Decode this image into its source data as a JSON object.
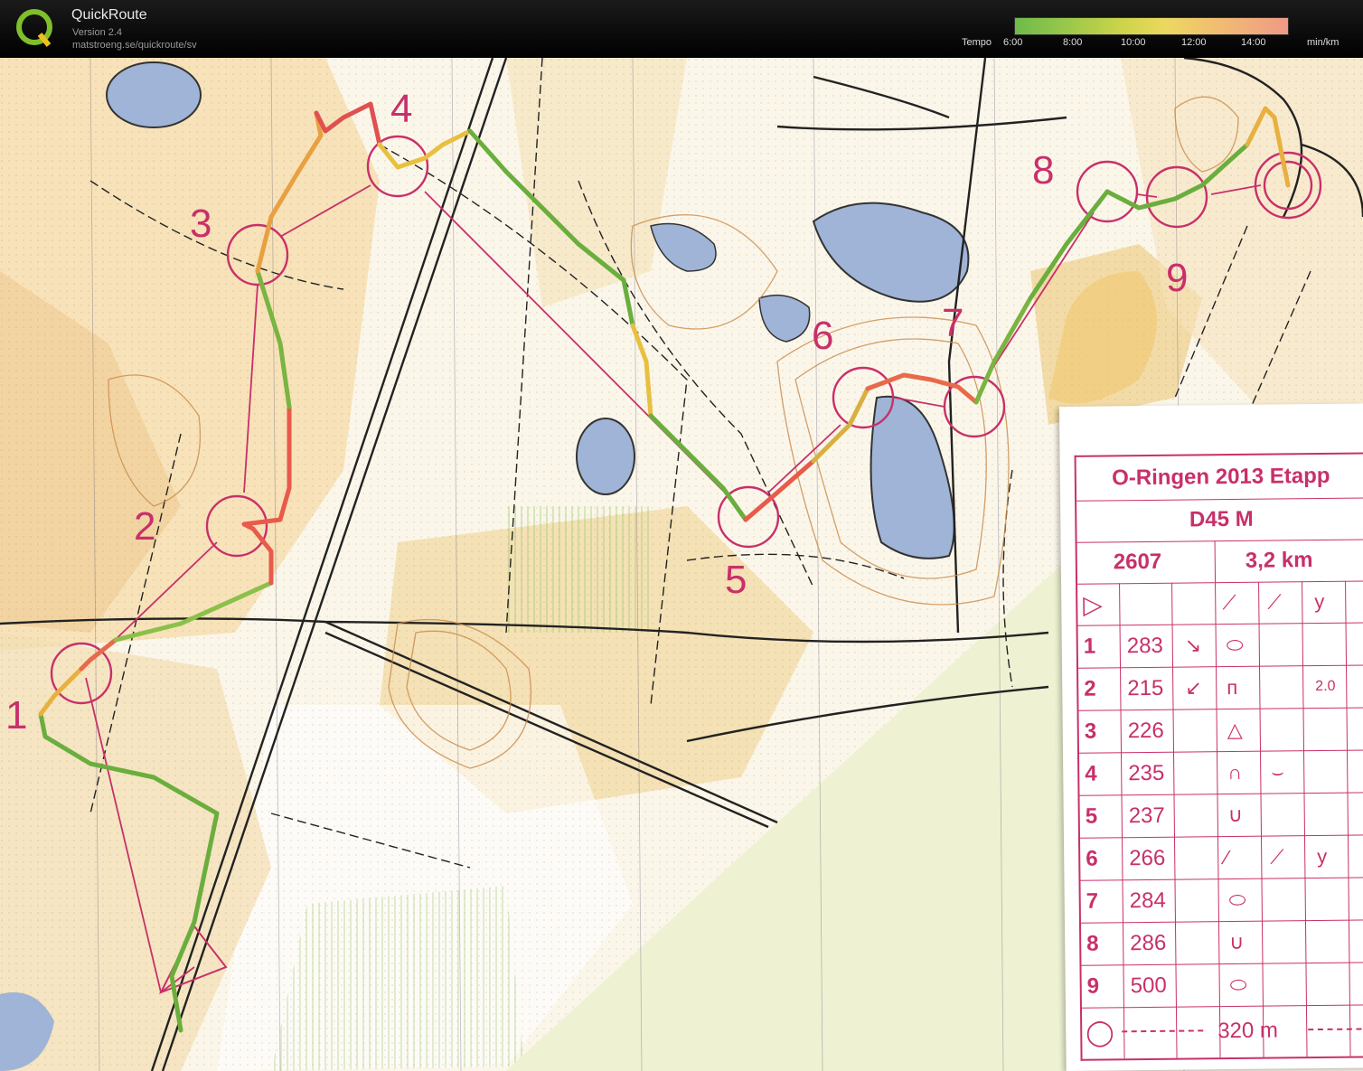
{
  "app": {
    "title": "QuickRoute",
    "version": "Version 2.4",
    "url": "matstroeng.se/quickroute/sv"
  },
  "pace_scale": {
    "label": "Tempo",
    "ticks": [
      "6:00",
      "8:00",
      "10:00",
      "12:00",
      "14:00"
    ],
    "unit": "min/km"
  },
  "map": {
    "control_numbers": [
      "1",
      "2",
      "3",
      "4",
      "5",
      "6",
      "7",
      "8",
      "9"
    ]
  },
  "legend": {
    "event": "O-Ringen 2013 Etapp",
    "course": "D45 M",
    "course_code": "2607",
    "length": "3,2 km",
    "controls": [
      {
        "num": "1",
        "code": "283",
        "symbol": "⬭"
      },
      {
        "num": "2",
        "code": "215",
        "symbol": "ᴨ",
        "extra": "2.0"
      },
      {
        "num": "3",
        "code": "226",
        "symbol": "△"
      },
      {
        "num": "4",
        "code": "235",
        "symbol": "∩"
      },
      {
        "num": "5",
        "code": "237",
        "symbol": "∪"
      },
      {
        "num": "6",
        "code": "266",
        "symbol": "⁄"
      },
      {
        "num": "7",
        "code": "284",
        "symbol": "⬭"
      },
      {
        "num": "8",
        "code": "286",
        "symbol": "∪"
      },
      {
        "num": "9",
        "code": "500",
        "symbol": "⬭"
      }
    ],
    "finish_distance": "320 m"
  },
  "colors": {
    "course": "#c8306a",
    "route_fast": "#5aa640",
    "route_mid": "#e0c040",
    "route_slow": "#e05050",
    "water": "#9fb4d6",
    "forest": "#f6e7c8"
  }
}
